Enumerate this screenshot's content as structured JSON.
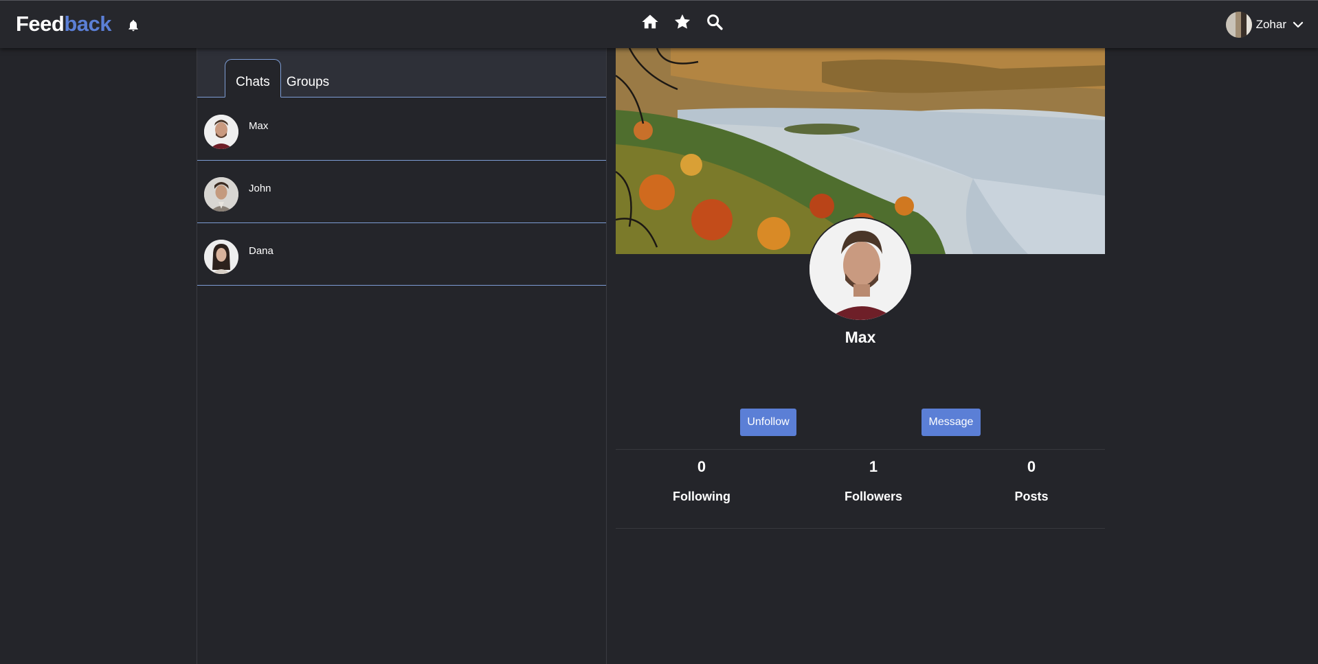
{
  "brand": {
    "part1": "Feed",
    "part2": "back"
  },
  "nav": {
    "icons": [
      "bell-icon",
      "home-icon",
      "star-icon",
      "search-icon",
      "chevron-down-icon"
    ],
    "user_name": "Zohar"
  },
  "chat_panel": {
    "tabs": [
      {
        "label": "Chats",
        "active": true
      },
      {
        "label": "Groups",
        "active": false
      }
    ],
    "chats": [
      {
        "name": "Max"
      },
      {
        "name": "John"
      },
      {
        "name": "Dana"
      }
    ]
  },
  "profile": {
    "name": "Max",
    "buttons": {
      "unfollow": "Unfollow",
      "message": "Message"
    },
    "stats": [
      {
        "value": "0",
        "label": "Following"
      },
      {
        "value": "1",
        "label": "Followers"
      },
      {
        "value": "0",
        "label": "Posts"
      }
    ]
  },
  "colors": {
    "background": "#24252a",
    "navbar": "#26272c",
    "accent": "#5b7fd6",
    "divider": "#7e9ed6"
  }
}
